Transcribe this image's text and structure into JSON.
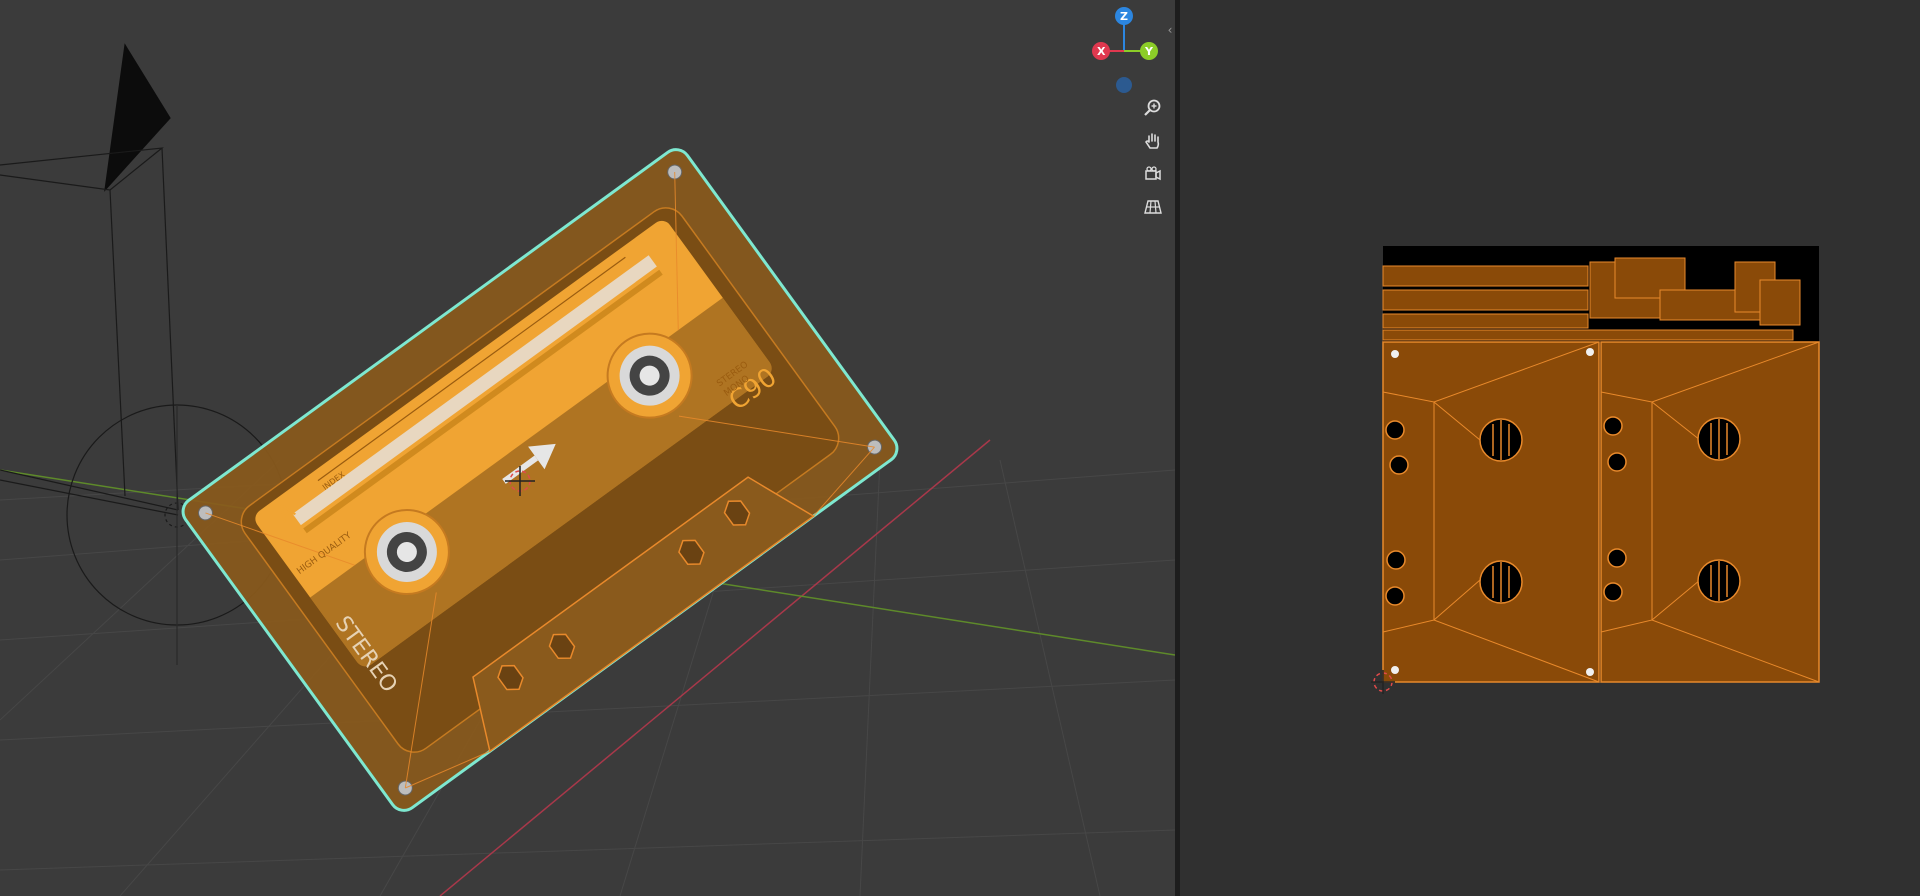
{
  "viewport": {
    "gizmo": {
      "z_label": "Z",
      "x_label": "X",
      "y_label": "Y"
    },
    "nav_buttons": [
      {
        "name": "zoom",
        "icon": "zoom-icon"
      },
      {
        "name": "pan",
        "icon": "hand-icon"
      },
      {
        "name": "camera",
        "icon": "camera-icon"
      },
      {
        "name": "perspective-toggle",
        "icon": "grid-icon"
      }
    ],
    "cassette_label": {
      "side": "A",
      "index": "INDEX",
      "quality": "HIGH QUALITY",
      "stereo": "STEREO",
      "model": "C90",
      "stereo_small": "STEREO",
      "mono_small": "MONO"
    }
  },
  "colors": {
    "viewport_bg": "#3b3b3b",
    "uv_bg": "#303030",
    "selection_orange": "#e8892b",
    "outline_cyan": "#7ee8d0",
    "label_orange": "#f0a433",
    "uv_fill": "#8a4a08",
    "axis_x": "#e0384f",
    "axis_y": "#8ccd28",
    "axis_z": "#2c86e0"
  },
  "uv_editor": {
    "description_icon": "uv-island-map"
  }
}
